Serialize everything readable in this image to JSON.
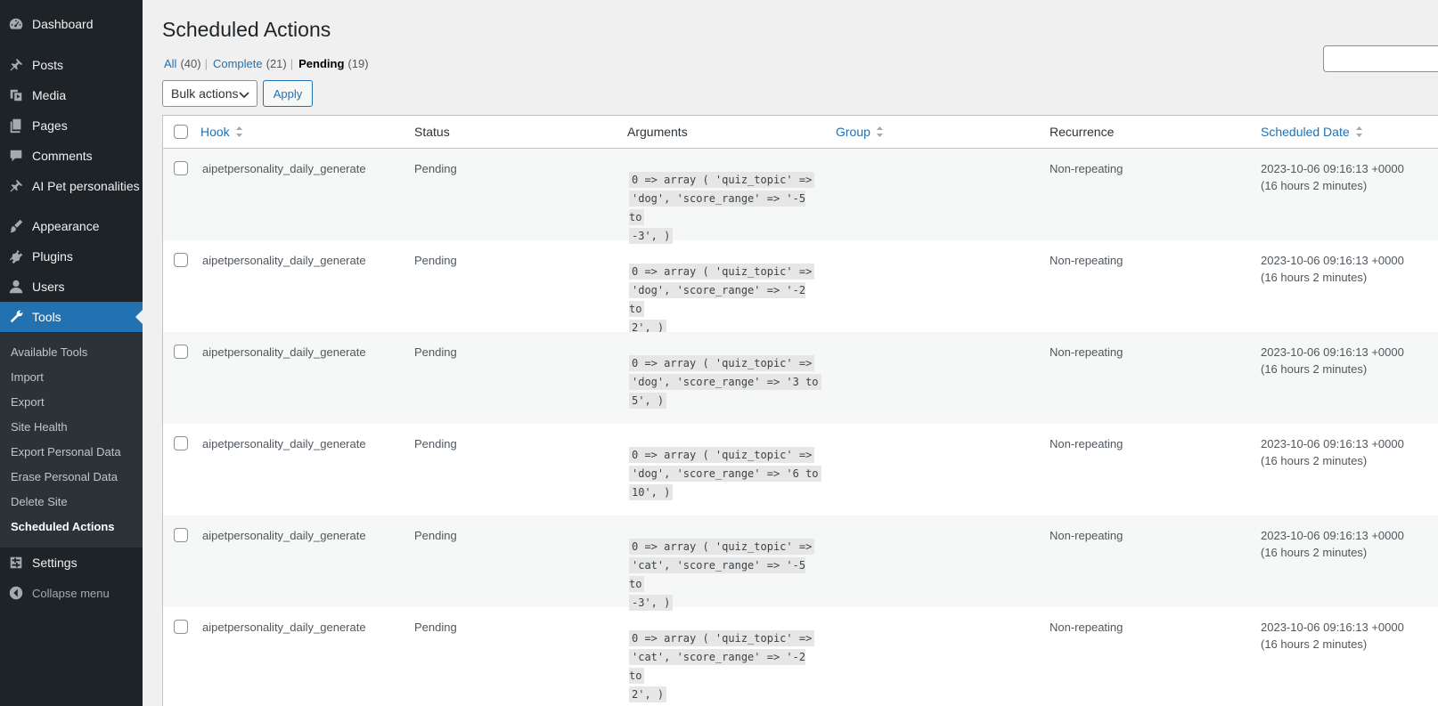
{
  "sidebar": {
    "items": [
      {
        "label": "Dashboard",
        "icon": "dashboard-icon"
      },
      {
        "label": "Posts",
        "icon": "pin-icon"
      },
      {
        "label": "Media",
        "icon": "media-icon"
      },
      {
        "label": "Pages",
        "icon": "pages-icon"
      },
      {
        "label": "Comments",
        "icon": "comment-icon"
      },
      {
        "label": "AI Pet personalities",
        "icon": "pin-icon"
      },
      {
        "label": "Appearance",
        "icon": "brush-icon"
      },
      {
        "label": "Plugins",
        "icon": "plugin-icon"
      },
      {
        "label": "Users",
        "icon": "user-icon"
      },
      {
        "label": "Tools",
        "icon": "wrench-icon"
      }
    ],
    "tools_submenu": [
      "Available Tools",
      "Import",
      "Export",
      "Site Health",
      "Export Personal Data",
      "Erase Personal Data",
      "Delete Site",
      "Scheduled Actions"
    ],
    "settings": {
      "label": "Settings",
      "icon": "settings-icon"
    },
    "collapse": {
      "label": "Collapse menu",
      "icon": "collapse-icon"
    }
  },
  "page": {
    "title": "Scheduled Actions",
    "views": [
      {
        "label": "All",
        "count": "(40)"
      },
      {
        "label": "Complete",
        "count": "(21)"
      },
      {
        "label": "Pending",
        "count": "(19)"
      }
    ],
    "bulk_actions_label": "Bulk actions",
    "apply_label": "Apply"
  },
  "table": {
    "columns": {
      "hook": "Hook",
      "status": "Status",
      "arguments": "Arguments",
      "group": "Group",
      "recurrence": "Recurrence",
      "scheduled_date": "Scheduled Date"
    },
    "rows": [
      {
        "hook": "aipetpersonality_daily_generate",
        "status": "Pending",
        "args": [
          "0 => array ( 'quiz_topic' =>",
          "'dog', 'score_range' => '-5 to",
          "-3', )"
        ],
        "recurrence": "Non-repeating",
        "date": "2023-10-06 09:16:13 +0000",
        "relative": "(16 hours 2 minutes)"
      },
      {
        "hook": "aipetpersonality_daily_generate",
        "status": "Pending",
        "args": [
          "0 => array ( 'quiz_topic' =>",
          "'dog', 'score_range' => '-2 to",
          "2', )"
        ],
        "recurrence": "Non-repeating",
        "date": "2023-10-06 09:16:13 +0000",
        "relative": "(16 hours 2 minutes)"
      },
      {
        "hook": "aipetpersonality_daily_generate",
        "status": "Pending",
        "args": [
          "0 => array ( 'quiz_topic' =>",
          "'dog', 'score_range' => '3 to",
          "5', )"
        ],
        "recurrence": "Non-repeating",
        "date": "2023-10-06 09:16:13 +0000",
        "relative": "(16 hours 2 minutes)"
      },
      {
        "hook": "aipetpersonality_daily_generate",
        "status": "Pending",
        "args": [
          "0 => array ( 'quiz_topic' =>",
          "'dog', 'score_range' => '6 to",
          "10', )"
        ],
        "recurrence": "Non-repeating",
        "date": "2023-10-06 09:16:13 +0000",
        "relative": "(16 hours 2 minutes)"
      },
      {
        "hook": "aipetpersonality_daily_generate",
        "status": "Pending",
        "args": [
          "0 => array ( 'quiz_topic' =>",
          "'cat', 'score_range' => '-5 to",
          "-3', )"
        ],
        "recurrence": "Non-repeating",
        "date": "2023-10-06 09:16:13 +0000",
        "relative": "(16 hours 2 minutes)"
      },
      {
        "hook": "aipetpersonality_daily_generate",
        "status": "Pending",
        "args": [
          "0 => array ( 'quiz_topic' =>",
          "'cat', 'score_range' => '-2 to",
          "2', )"
        ],
        "recurrence": "Non-repeating",
        "date": "2023-10-06 09:16:13 +0000",
        "relative": "(16 hours 2 minutes)"
      }
    ]
  }
}
